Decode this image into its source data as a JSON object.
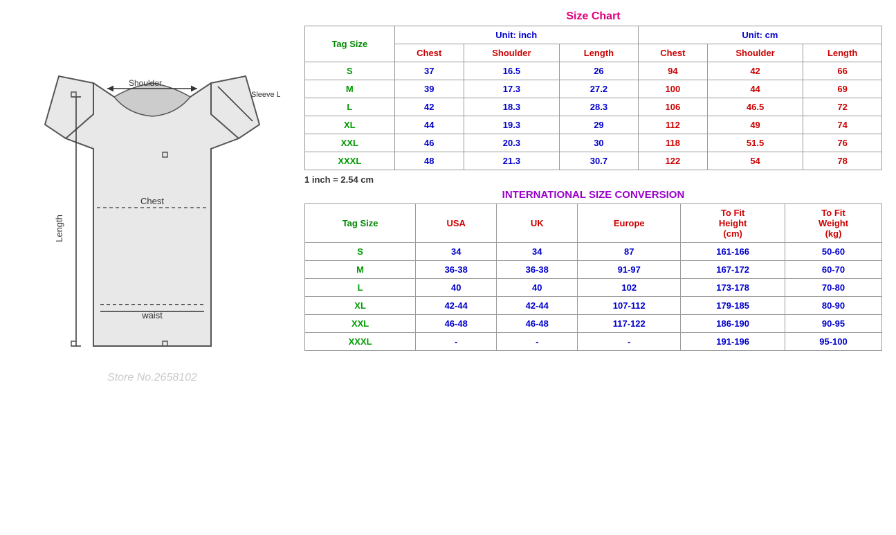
{
  "sizeChart": {
    "title": "Size Chart",
    "unitInch": "Unit: inch",
    "unitCm": "Unit: cm",
    "tagSizeLabel": "Tag Size",
    "inchColumns": [
      "Chest",
      "Shoulder",
      "Length"
    ],
    "cmColumns": [
      "Chest",
      "Shoulder",
      "Length"
    ],
    "rows": [
      {
        "tag": "S",
        "inchChest": "37",
        "inchShoulder": "16.5",
        "inchLength": "26",
        "cmChest": "94",
        "cmShoulder": "42",
        "cmLength": "66"
      },
      {
        "tag": "M",
        "inchChest": "39",
        "inchShoulder": "17.3",
        "inchLength": "27.2",
        "cmChest": "100",
        "cmShoulder": "44",
        "cmLength": "69"
      },
      {
        "tag": "L",
        "inchChest": "42",
        "inchShoulder": "18.3",
        "inchLength": "28.3",
        "cmChest": "106",
        "cmShoulder": "46.5",
        "cmLength": "72"
      },
      {
        "tag": "XL",
        "inchChest": "44",
        "inchShoulder": "19.3",
        "inchLength": "29",
        "cmChest": "112",
        "cmShoulder": "49",
        "cmLength": "74"
      },
      {
        "tag": "XXL",
        "inchChest": "46",
        "inchShoulder": "20.3",
        "inchLength": "30",
        "cmChest": "118",
        "cmShoulder": "51.5",
        "cmLength": "76"
      },
      {
        "tag": "XXXL",
        "inchChest": "48",
        "inchShoulder": "21.3",
        "inchLength": "30.7",
        "cmChest": "122",
        "cmShoulder": "54",
        "cmLength": "78"
      }
    ],
    "conversionNote": "1 inch = 2.54 cm"
  },
  "intlConversion": {
    "title": "INTERNATIONAL SIZE CONVERSION",
    "tagSizeLabel": "Tag Size",
    "columns": [
      "USA",
      "UK",
      "Europe",
      "To Fit Height (cm)",
      "To Fit Weight (kg)"
    ],
    "rows": [
      {
        "tag": "S",
        "usa": "34",
        "uk": "34",
        "europe": "87",
        "height": "161-166",
        "weight": "50-60"
      },
      {
        "tag": "M",
        "usa": "36-38",
        "uk": "36-38",
        "europe": "91-97",
        "height": "167-172",
        "weight": "60-70"
      },
      {
        "tag": "L",
        "usa": "40",
        "uk": "40",
        "europe": "102",
        "height": "173-178",
        "weight": "70-80"
      },
      {
        "tag": "XL",
        "usa": "42-44",
        "uk": "42-44",
        "europe": "107-112",
        "height": "179-185",
        "weight": "80-90"
      },
      {
        "tag": "XXL",
        "usa": "46-48",
        "uk": "46-48",
        "europe": "117-122",
        "height": "186-190",
        "weight": "90-95"
      },
      {
        "tag": "XXXL",
        "usa": "-",
        "uk": "-",
        "europe": "-",
        "height": "191-196",
        "weight": "95-100"
      }
    ]
  },
  "diagram": {
    "shoulderLabel": "Shoulder",
    "chestLabel": "Chest",
    "lengthLabel": "Length",
    "waistLabel": "waist",
    "sleeveLengthLabel": "Sleeve Length"
  }
}
